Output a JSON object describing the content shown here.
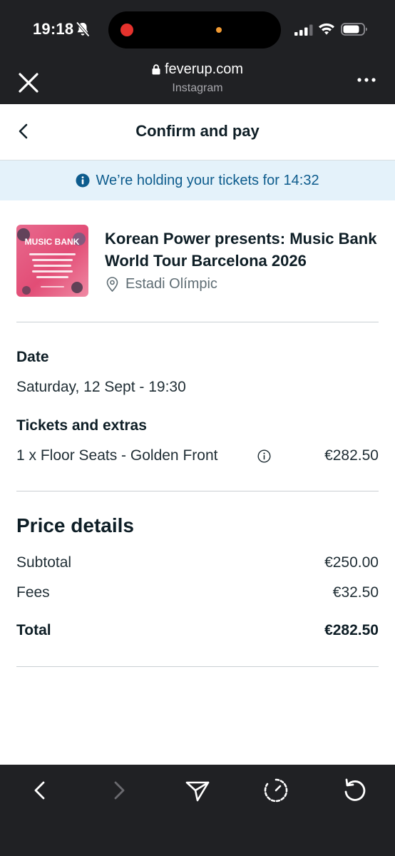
{
  "status_bar": {
    "time": "19:18"
  },
  "browser": {
    "url": "feverup.com",
    "source": "Instagram"
  },
  "header": {
    "title": "Confirm and pay"
  },
  "banner": {
    "text": "We’re holding your tickets for 14:32"
  },
  "event": {
    "poster_caption": "MUSIC BANK",
    "title": "Korean Power presents: Music Bank World Tour Barcelona 2026",
    "venue": "Estadi Olímpic"
  },
  "date": {
    "label": "Date",
    "value": "Saturday, 12 Sept - 19:30"
  },
  "tickets": {
    "label": "Tickets and extras",
    "item": "1 x Floor Seats - Golden Front",
    "price": "€282.50"
  },
  "price_details": {
    "heading": "Price details",
    "subtotal_label": "Subtotal",
    "subtotal_value": "€250.00",
    "fees_label": "Fees",
    "fees_value": "€32.50",
    "total_label": "Total",
    "total_value": "€282.50"
  },
  "colors": {
    "chrome": "#202124",
    "banner_bg": "#e4f2fa",
    "banner_text": "#0d5c8d",
    "text": "#0e1e26"
  },
  "icons": {
    "close": "close-icon",
    "lock": "lock-icon",
    "more": "more-icon",
    "back": "chevron-left-icon",
    "info": "info-icon",
    "pin": "location-pin-icon",
    "nav_back": "chevron-left-icon",
    "nav_forward": "chevron-right-icon",
    "send": "send-icon",
    "timer": "timer-icon",
    "reload": "reload-icon"
  }
}
